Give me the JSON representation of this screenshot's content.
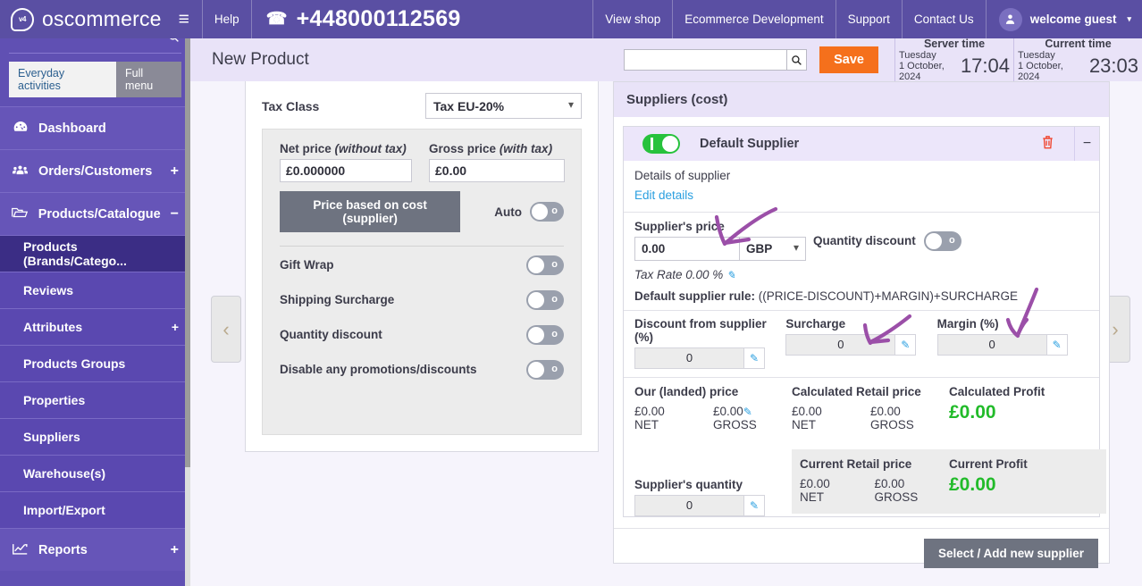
{
  "topbar": {
    "brand": "oscommerce",
    "brand_badge": "v4",
    "menu_icon": "≡",
    "help": "Help",
    "phone_icon": "☎",
    "phone": "+448000112569",
    "links": [
      "View shop",
      "Ecommerce Development",
      "Support",
      "Contact Us"
    ],
    "user": "welcome guest",
    "user_icon": "♟",
    "caret": "▾"
  },
  "sidebar": {
    "search_icon": "⌕",
    "segments": [
      {
        "label": "Everyday activities",
        "active": true
      },
      {
        "label": "Full menu",
        "active": false
      }
    ],
    "items": [
      {
        "label": "Dashboard",
        "icon": "◔",
        "expand": "",
        "level": 1,
        "selected": false
      },
      {
        "label": "Orders/Customers",
        "icon": "♟",
        "expand": "+",
        "level": 1,
        "selected": false
      },
      {
        "label": "Products/Catalogue",
        "icon": "▱",
        "expand": "−",
        "level": 1,
        "selected": false
      },
      {
        "label": "Products (Brands/Catego...",
        "icon": "",
        "expand": "",
        "level": 2,
        "selected": true
      },
      {
        "label": "Reviews",
        "icon": "",
        "expand": "",
        "level": 2,
        "selected": false
      },
      {
        "label": "Attributes",
        "icon": "",
        "expand": "+",
        "level": 2,
        "selected": false
      },
      {
        "label": "Products Groups",
        "icon": "",
        "expand": "",
        "level": 2,
        "selected": false
      },
      {
        "label": "Properties",
        "icon": "",
        "expand": "",
        "level": 2,
        "selected": false
      },
      {
        "label": "Suppliers",
        "icon": "",
        "expand": "",
        "level": 2,
        "selected": false
      },
      {
        "label": "Warehouse(s)",
        "icon": "",
        "expand": "",
        "level": 2,
        "selected": false
      },
      {
        "label": "Import/Export",
        "icon": "",
        "expand": "",
        "level": 2,
        "selected": false
      },
      {
        "label": "Reports",
        "icon": "↗",
        "expand": "+",
        "level": 1,
        "selected": false
      }
    ]
  },
  "pagehead": {
    "title": "New Product",
    "search_value": "",
    "search_icon": "⌕",
    "save_label": "Save",
    "server_time": {
      "title": "Server time",
      "day": "Tuesday",
      "date": "1 October, 2024",
      "clock": "17:04"
    },
    "current_time": {
      "title": "Current time",
      "day": "Tuesday",
      "date": "1 October, 2024",
      "clock": "23:03"
    }
  },
  "nav_arrows": {
    "prev": "‹",
    "next": "›"
  },
  "left_panel": {
    "tax_class_label": "Tax Class",
    "tax_class_value": "Tax EU-20%",
    "net_price_label": "Net price",
    "net_price_note": "(without tax)",
    "net_price_value": "£0.000000",
    "gross_price_label": "Gross price",
    "gross_price_note": "(with tax)",
    "gross_price_value": "£0.00",
    "cost_button": "Price based on cost (supplier)",
    "auto_label": "Auto",
    "auto_state": "off",
    "options": [
      {
        "label": "Gift Wrap",
        "state": "off"
      },
      {
        "label": "Shipping Surcharge",
        "state": "off"
      },
      {
        "label": "Quantity discount",
        "state": "off"
      },
      {
        "label": "Disable any promotions/discounts",
        "state": "off"
      }
    ]
  },
  "right_panel": {
    "header": "Suppliers (cost)",
    "supplier": {
      "enabled": true,
      "name": "Default Supplier",
      "trash_icon": "🗑",
      "collapse_icon": "−",
      "details_text": "Details of supplier",
      "edit_link": "Edit details",
      "price_label": "Supplier's price",
      "price_value": "0.00",
      "currency": "GBP",
      "qty_discount_label": "Quantity discount",
      "qty_discount_state": "off",
      "tax_rate_text": "Tax Rate 0.00 %",
      "rule_label": "Default supplier rule:",
      "rule_formula": "((PRICE-DISCOUNT)+MARGIN)+SURCHARGE",
      "steppers": [
        {
          "label": "Discount from supplier (%)",
          "value": "0"
        },
        {
          "label": "Surcharge",
          "value": "0"
        },
        {
          "label": "Margin (%)",
          "value": "0"
        }
      ],
      "landed": {
        "title": "Our (landed) price",
        "net": "£0.00",
        "net_label": "NET",
        "gross": "£0.00",
        "gross_label": "GROSS"
      },
      "calc_retail": {
        "title": "Calculated Retail price",
        "net": "£0.00",
        "net_label": "NET",
        "gross": "£0.00",
        "gross_label": "GROSS"
      },
      "calc_profit": {
        "title": "Calculated Profit",
        "value": "£0.00"
      },
      "current_retail": {
        "title": "Current Retail price",
        "net": "£0.00",
        "net_label": "NET",
        "gross": "£0.00",
        "gross_label": "GROSS"
      },
      "current_profit": {
        "title": "Current Profit",
        "value": "£0.00"
      },
      "supplier_qty_label": "Supplier's quantity",
      "supplier_qty_value": "0"
    },
    "add_supplier_button": "Select / Add new supplier"
  },
  "colors": {
    "brand_purple": "#5a4fa3",
    "sidebar_purple": "#6050b3",
    "sidebar_selected": "#3b2d85",
    "accent_orange": "#f5701c",
    "profit_green": "#22bb2a",
    "toggle_on_green": "#27c23c",
    "link_blue": "#2a9fe0",
    "trash_red": "#f0452e",
    "annotation_purple": "#9b4fa8"
  }
}
